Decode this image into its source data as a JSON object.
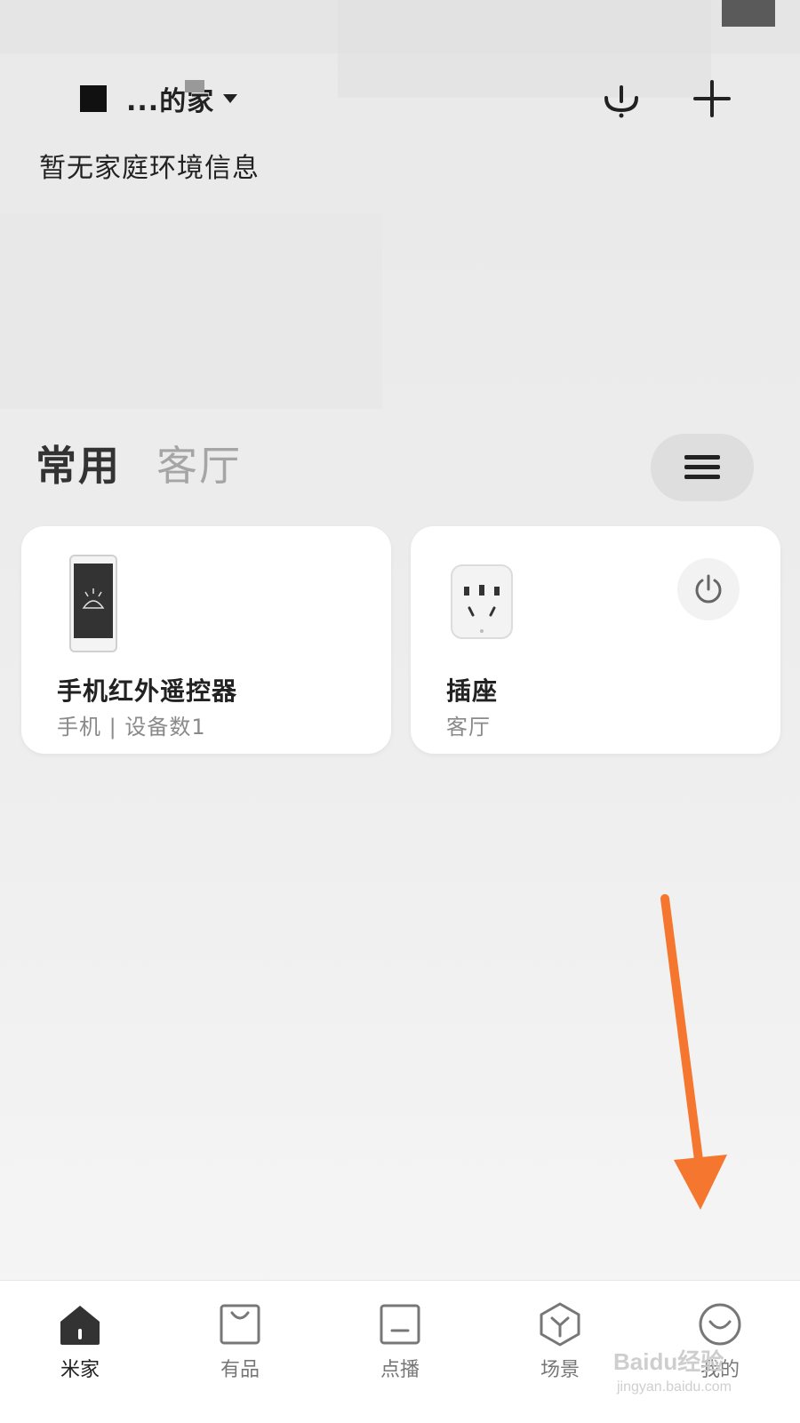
{
  "header": {
    "home_name": "...的家",
    "env_info": "暂无家庭环境信息"
  },
  "tabs": [
    {
      "label": "常用",
      "active": true
    },
    {
      "label": "客厅",
      "active": false
    }
  ],
  "devices": [
    {
      "name": "手机红外遥控器",
      "meta": "手机 | 设备数1",
      "icon": "phone-ir-remote-icon"
    },
    {
      "name": "插座",
      "meta": "客厅",
      "icon": "smart-plug-icon"
    }
  ],
  "bottom_nav": [
    {
      "label": "米家",
      "icon": "home-icon",
      "active": true
    },
    {
      "label": "有品",
      "icon": "shopping-bag-icon",
      "active": false
    },
    {
      "label": "点播",
      "icon": "tv-icon",
      "active": false
    },
    {
      "label": "场景",
      "icon": "scene-cube-icon",
      "active": false
    },
    {
      "label": "我的",
      "icon": "profile-smile-icon",
      "active": false
    }
  ],
  "watermark": {
    "text": "Baidu经验",
    "sub": "jingyan.baidu.com"
  },
  "colors": {
    "accent_arrow": "#F5772F",
    "text_primary": "#222222",
    "text_secondary": "#8A8A8A",
    "tab_inactive": "#A5A5A5"
  }
}
